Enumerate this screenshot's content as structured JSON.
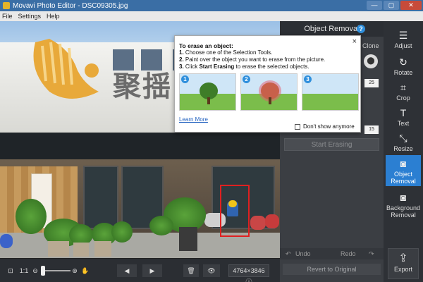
{
  "window": {
    "title": "Movavi Photo Editor - DSC09305.jpg",
    "minimize": "—",
    "maximize": "▢",
    "close": "✕"
  },
  "menu": [
    "File",
    "Settings",
    "Help"
  ],
  "panel": {
    "title": "Object Removal",
    "help": "?",
    "clone_label": "Clone",
    "size_a": "25",
    "size_b": "15",
    "start_erasing": "Start Erasing",
    "undo": "Undo",
    "redo": "Redo",
    "revert": "Revert to Original"
  },
  "popup": {
    "close": "×",
    "heading": "To erase an object:",
    "steps": [
      {
        "num": "1.",
        "text": "Choose one of the Selection Tools."
      },
      {
        "num": "2.",
        "text": "Paint over the object you want to erase from the picture."
      },
      {
        "num": "3.",
        "pre": "Click ",
        "bold": "Start Erasing",
        "post": " to erase the selected objects."
      }
    ],
    "thumb_numbers": [
      "1",
      "2",
      "3"
    ],
    "learn_more": "Learn More",
    "dont_show": "Don't show anymore"
  },
  "tools": [
    {
      "label": "Adjust",
      "icon": "sliders-icon",
      "glyph": "☰"
    },
    {
      "label": "Rotate",
      "icon": "rotate-icon",
      "glyph": "↻"
    },
    {
      "label": "Crop",
      "icon": "crop-icon",
      "glyph": "⌗"
    },
    {
      "label": "Text",
      "icon": "text-icon",
      "glyph": "T"
    },
    {
      "label": "Resize",
      "icon": "resize-icon",
      "glyph": "⤡"
    },
    {
      "label": "Object Removal",
      "icon": "eraser-icon",
      "glyph": "◙",
      "active": true
    },
    {
      "label": "Background Removal",
      "icon": "background-icon",
      "glyph": "◙"
    }
  ],
  "export": {
    "label": "Export",
    "glyph": "⇪"
  },
  "bottom": {
    "fit": "⊡",
    "one_to_one": "1:1",
    "zoom_out": "⊖",
    "zoom_in": "⊕",
    "hand": "✋",
    "prev": "◀",
    "next": "▶",
    "delete": "🗑",
    "eye": "👁",
    "dimensions": "4764×3846",
    "info": "ⓘ"
  },
  "image": {
    "sign_text": "聚揺"
  },
  "colors": {
    "accent": "#2b7fd2",
    "panel_bg": "#3b3e43",
    "selection": "#e02020"
  }
}
